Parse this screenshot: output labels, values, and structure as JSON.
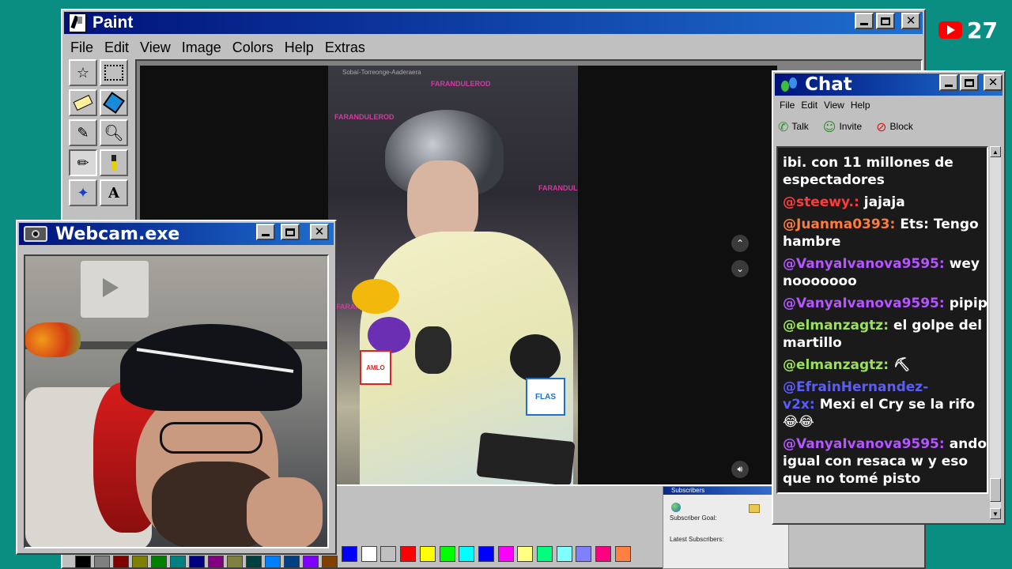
{
  "paint": {
    "title": "Paint",
    "menu": [
      "File",
      "Edit",
      "View",
      "Image",
      "Colors",
      "Help",
      "Extras"
    ]
  },
  "video": {
    "top_text": "Sobaí-Torreonge-Aaderaera",
    "watermark": "FARANDULEROD",
    "mic_logos": [
      "AMLO",
      "FLAS"
    ]
  },
  "webcam": {
    "title": "Webcam.exe"
  },
  "chat": {
    "title": "Chat",
    "menu": [
      "File",
      "Edit",
      "View",
      "Help"
    ],
    "toolbar": {
      "talk": "Talk",
      "invite": "Invite",
      "block": "Block"
    },
    "messages": [
      {
        "user": "",
        "text": "ibi. con 11 millones de espectadores",
        "color": "#ffffff"
      },
      {
        "user": "@steewy.:",
        "text": "jajaja",
        "color": "#ff3b3b"
      },
      {
        "user": "@Juanma0393:",
        "text": "Ets: Tengo hambre",
        "color": "#ff7a3d"
      },
      {
        "user": "@VanyaIvanova9595:",
        "text": "wey nooooooo",
        "color": "#b455ff"
      },
      {
        "user": "@VanyaIvanova9595:",
        "text": "pipipi",
        "color": "#b455ff"
      },
      {
        "user": "@elmanzagtz:",
        "text": "el golpe del martillo",
        "color": "#9be05a"
      },
      {
        "user": "@elmanzagtz:",
        "text": "⛏",
        "color": "#9be05a"
      },
      {
        "user": "@EfrainHernandez-v2x:",
        "text": "Mexi el Cry se la rifo 😂😂",
        "color": "#5a5cff"
      },
      {
        "user": "@VanyaIvanova9595:",
        "text": "ando igual con resaca w y eso que no tomé pisto",
        "color": "#b455ff"
      }
    ]
  },
  "subscribers": {
    "title": "Subscribers",
    "goal_label": "Subscriber Goal:",
    "latest_label": "Latest Subscribers:"
  },
  "youtube_badge": {
    "count": "27"
  },
  "palette": [
    "#000000",
    "#808080",
    "#800000",
    "#808000",
    "#008000",
    "#008080",
    "#000080",
    "#800080",
    "#808040",
    "#004040",
    "#0080ff",
    "#004080",
    "#8000ff",
    "#804000",
    "#0000ff",
    "#ffffff",
    "#c0c0c0",
    "#ff0000",
    "#ffff00",
    "#00ff00",
    "#00ffff",
    "#0000ff",
    "#ff00ff",
    "#ffff80",
    "#00ff80",
    "#80ffff",
    "#8080ff",
    "#ff0080",
    "#ff8040"
  ]
}
